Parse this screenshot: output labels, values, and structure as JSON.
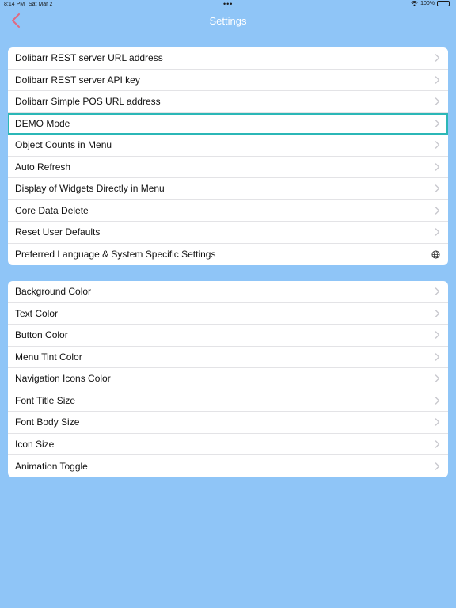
{
  "status_bar": {
    "time": "8:14 PM",
    "date": "Sat Mar 2",
    "dots": "•••",
    "battery_text": "100%"
  },
  "nav": {
    "title": "Settings",
    "back_icon": "chevron-left-icon",
    "back_color": "#e06a82"
  },
  "groups": [
    {
      "items": [
        {
          "label": "Dolibarr REST server URL address",
          "accessory": "chevron-right-icon"
        },
        {
          "label": "Dolibarr REST server API key",
          "accessory": "chevron-right-icon"
        },
        {
          "label": "Dolibarr Simple POS URL address",
          "accessory": "chevron-right-icon"
        },
        {
          "label": "DEMO Mode",
          "accessory": "chevron-right-icon",
          "selected": true
        },
        {
          "label": "Object Counts in Menu",
          "accessory": "chevron-right-icon"
        },
        {
          "label": "Auto Refresh",
          "accessory": "chevron-right-icon"
        },
        {
          "label": "Display of Widgets Directly in Menu",
          "accessory": "chevron-right-icon"
        },
        {
          "label": "Core Data Delete",
          "accessory": "chevron-right-icon"
        },
        {
          "label": "Reset User Defaults",
          "accessory": "chevron-right-icon"
        },
        {
          "label": "Preferred Language & System Specific Settings",
          "accessory": "globe-icon"
        }
      ]
    },
    {
      "items": [
        {
          "label": "Background Color",
          "accessory": "chevron-right-icon"
        },
        {
          "label": "Text Color",
          "accessory": "chevron-right-icon"
        },
        {
          "label": "Button Color",
          "accessory": "chevron-right-icon"
        },
        {
          "label": "Menu Tint Color",
          "accessory": "chevron-right-icon"
        },
        {
          "label": "Navigation Icons Color",
          "accessory": "chevron-right-icon"
        },
        {
          "label": "Font Title Size",
          "accessory": "chevron-right-icon"
        },
        {
          "label": "Font Body Size",
          "accessory": "chevron-right-icon"
        },
        {
          "label": "Icon Size",
          "accessory": "chevron-right-icon"
        },
        {
          "label": "Animation Toggle",
          "accessory": "chevron-right-icon"
        }
      ]
    }
  ],
  "colors": {
    "background": "#8fc5f7",
    "selected_outline": "#2bb7b7",
    "chevron": "#c7c7cc"
  }
}
